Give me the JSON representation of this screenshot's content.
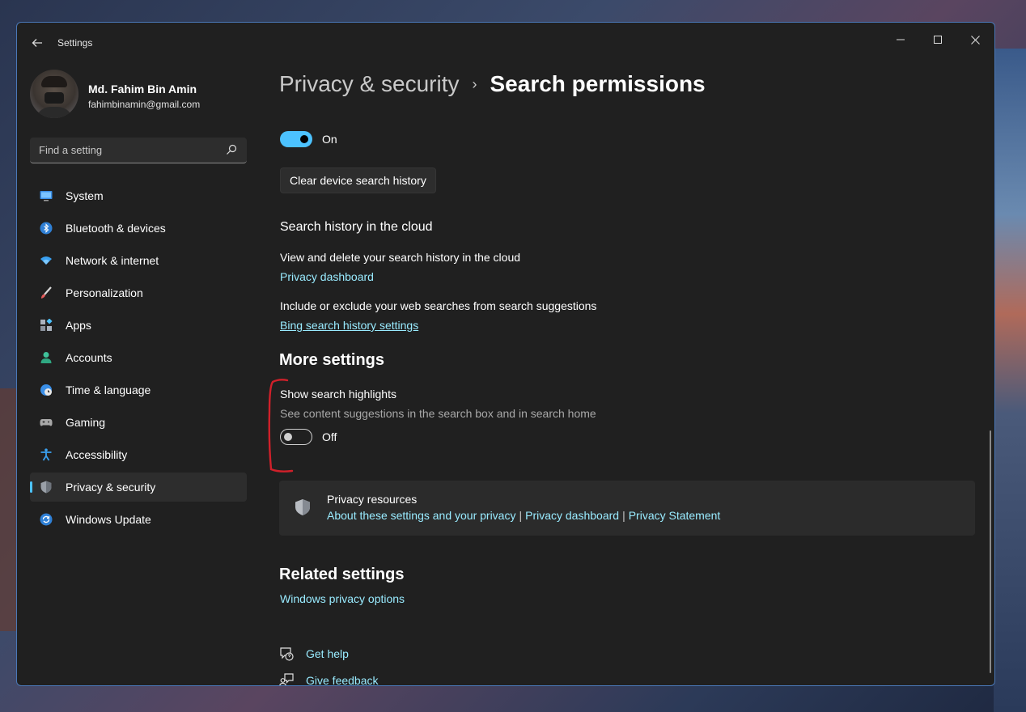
{
  "window": {
    "title": "Settings"
  },
  "profile": {
    "name": "Md. Fahim Bin Amin",
    "email": "fahimbinamin@gmail.com"
  },
  "search": {
    "placeholder": "Find a setting"
  },
  "sidebar": {
    "items": [
      {
        "label": "System",
        "icon": "system-icon"
      },
      {
        "label": "Bluetooth & devices",
        "icon": "bluetooth-icon"
      },
      {
        "label": "Network & internet",
        "icon": "wifi-icon"
      },
      {
        "label": "Personalization",
        "icon": "brush-icon"
      },
      {
        "label": "Apps",
        "icon": "apps-icon"
      },
      {
        "label": "Accounts",
        "icon": "person-icon"
      },
      {
        "label": "Time & language",
        "icon": "globe-clock-icon"
      },
      {
        "label": "Gaming",
        "icon": "gamepad-icon"
      },
      {
        "label": "Accessibility",
        "icon": "accessibility-icon"
      },
      {
        "label": "Privacy & security",
        "icon": "shield-icon",
        "active": true
      },
      {
        "label": "Windows Update",
        "icon": "update-icon"
      }
    ]
  },
  "header": {
    "parent": "Privacy & security",
    "separator": "›",
    "current": "Search permissions"
  },
  "device_history": {
    "toggle_state": "On",
    "toggle_on": true,
    "clear_button": "Clear device search history"
  },
  "cloud": {
    "heading": "Search history in the cloud",
    "view_text": "View and delete your search history in the cloud",
    "view_link": "Privacy dashboard",
    "include_text": "Include or exclude your web searches from search suggestions",
    "include_link": "Bing search history settings"
  },
  "more_settings": {
    "heading": "More settings",
    "highlights_title": "Show search highlights",
    "highlights_desc": "See content suggestions in the search box and in search home",
    "toggle_state": "Off",
    "toggle_on": false
  },
  "privacy_resources": {
    "title": "Privacy resources",
    "links": [
      "About these settings and your privacy",
      "Privacy dashboard",
      "Privacy Statement"
    ],
    "separator": "|"
  },
  "related": {
    "heading": "Related settings",
    "link": "Windows privacy options"
  },
  "help": {
    "get_help": "Get help",
    "give_feedback": "Give feedback"
  },
  "colors": {
    "accent": "#4cc2ff",
    "link": "#99ebff",
    "window_bg": "#202020",
    "annotation": "#d0202a"
  }
}
